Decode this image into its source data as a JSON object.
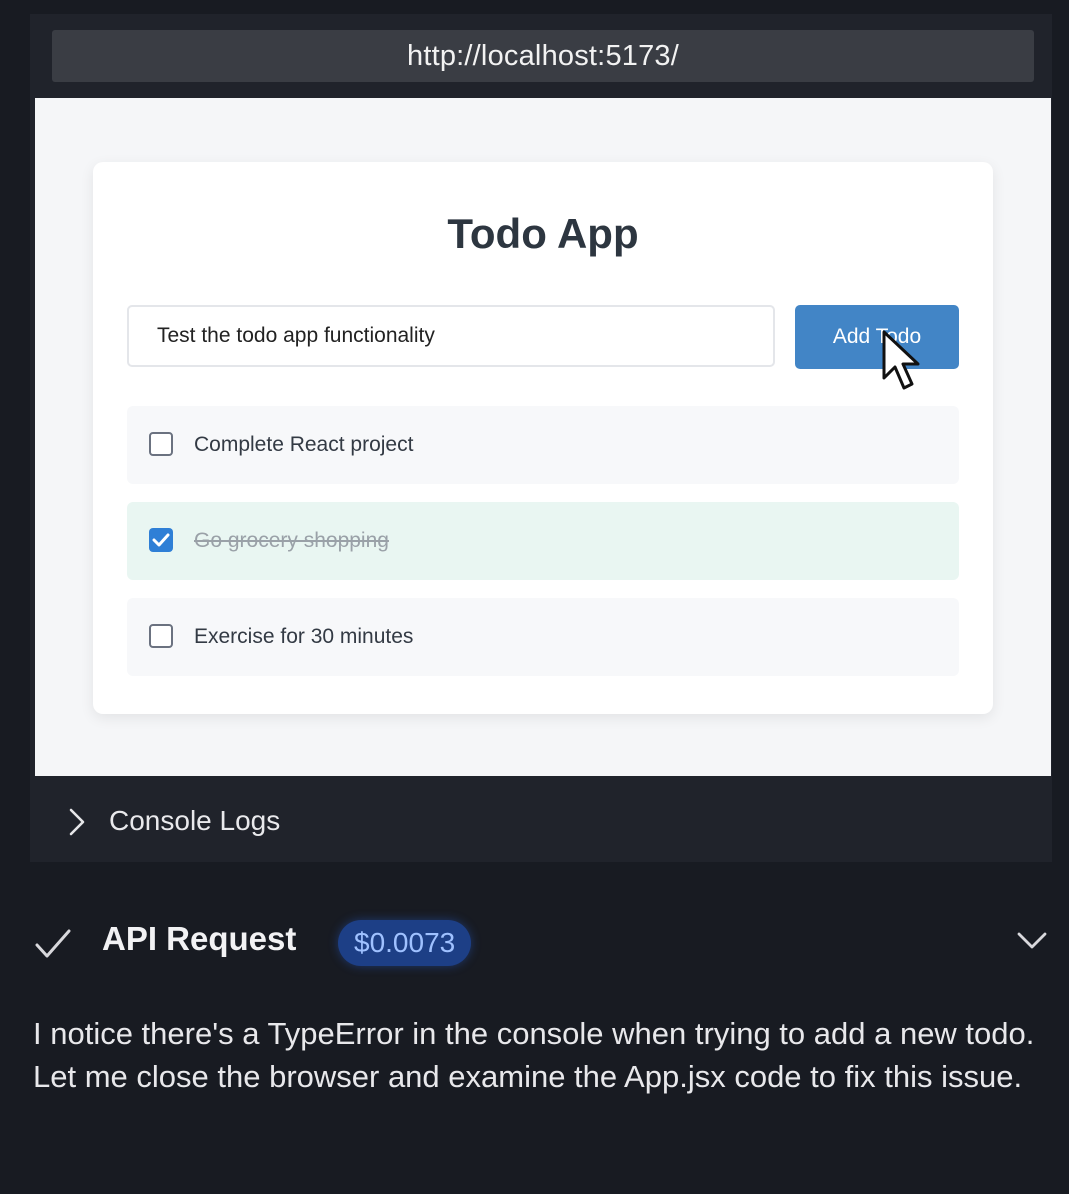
{
  "browser": {
    "url": "http://localhost:5173/"
  },
  "app": {
    "title": "Todo App",
    "input": {
      "value": "Test the todo app functionality",
      "placeholder": ""
    },
    "add_button_label": "Add Todo",
    "todos": [
      {
        "text": "Complete React project",
        "completed": false
      },
      {
        "text": "Go grocery shopping",
        "completed": true
      },
      {
        "text": "Exercise for 30 minutes",
        "completed": false
      }
    ]
  },
  "console": {
    "label": "Console Logs",
    "icon": "chevron-right-icon"
  },
  "api_request": {
    "status_icon": "check-icon",
    "title": "API Request",
    "cost": "$0.0073",
    "toggle_icon": "chevron-down-icon"
  },
  "message": {
    "text": "I notice there's a TypeError in the console when trying to add a new todo. Let me close the browser and examine the App.jsx code to fix this issue."
  },
  "colors": {
    "background": "#181b22",
    "accent_button": "#4285c6",
    "badge_bg": "#1d3f86",
    "badge_text": "#9fc1ff"
  }
}
